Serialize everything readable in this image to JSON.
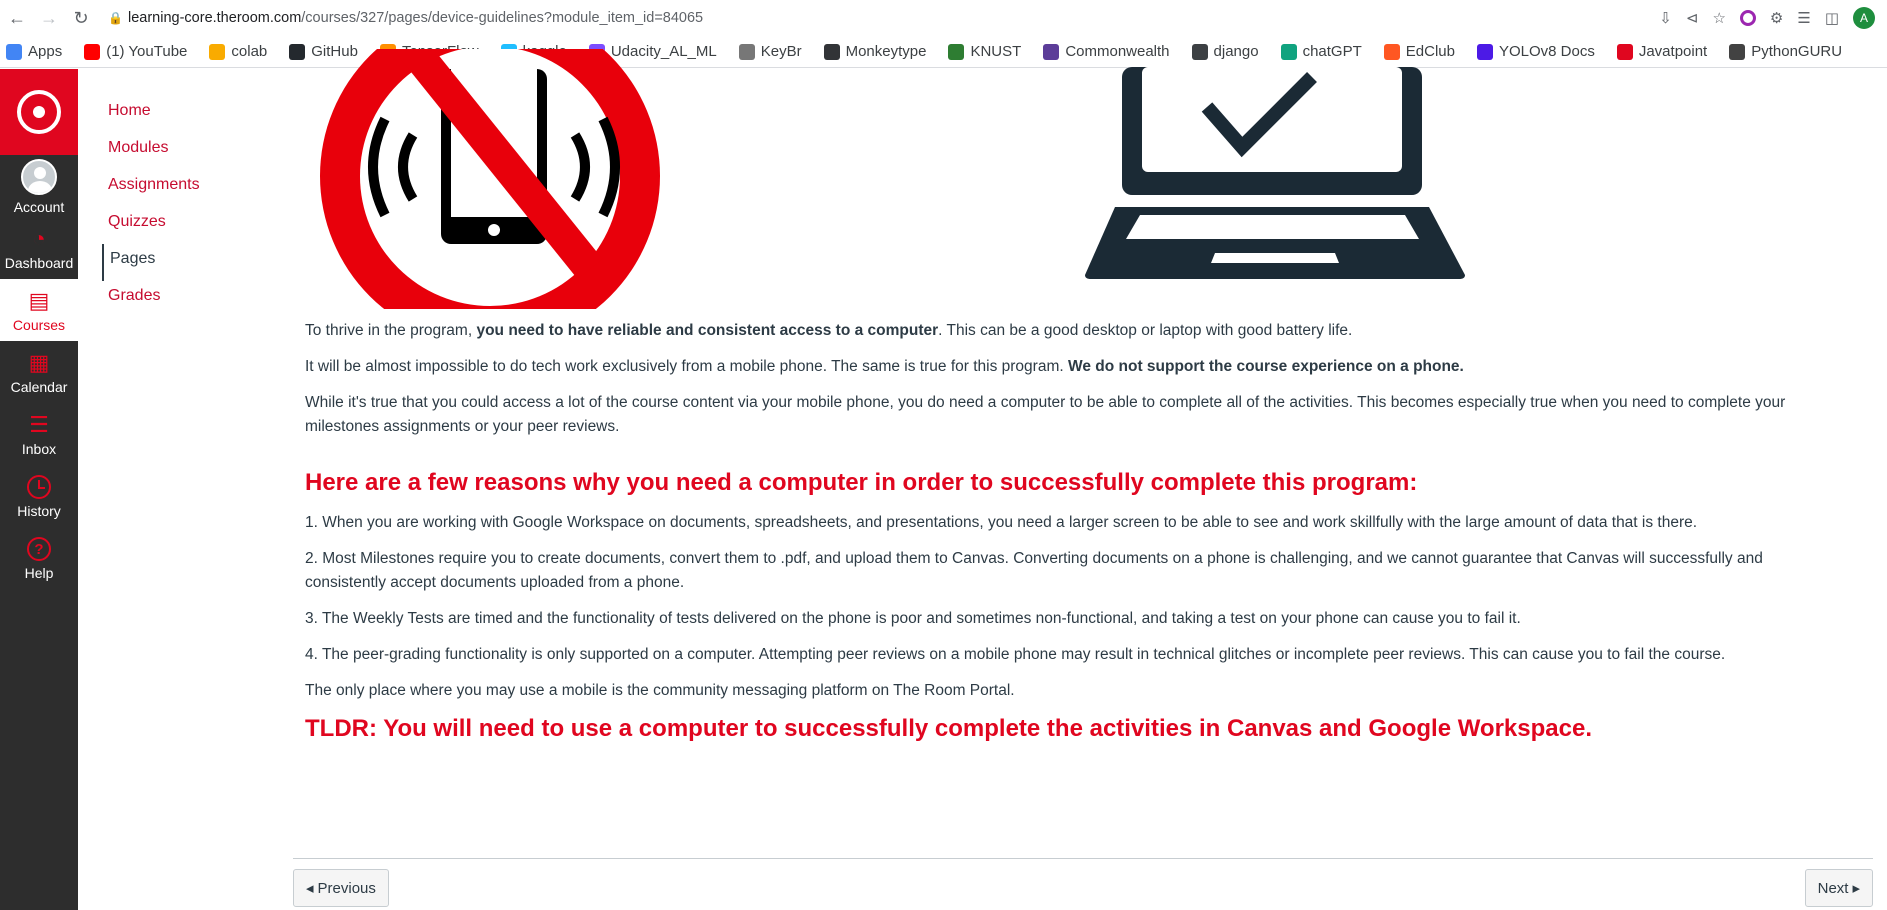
{
  "browser": {
    "url_host": "learning-core.theroom.com",
    "url_path": "/courses/327/pages/device-guidelines?module_item_id=84065",
    "avatar_letter": "A"
  },
  "bookmarks": [
    {
      "label": "Apps",
      "icon": "apps-grid-icon",
      "color": "#4285f4"
    },
    {
      "label": "(1) YouTube",
      "icon": "youtube-icon",
      "color": "#ff0000"
    },
    {
      "label": "colab",
      "icon": "colab-icon",
      "color": "#f9ab00"
    },
    {
      "label": "GitHub",
      "icon": "github-icon",
      "color": "#24292e"
    },
    {
      "label": "TensorFlow",
      "icon": "tensorflow-icon",
      "color": "#ff8f00"
    },
    {
      "label": "kaggle",
      "icon": "kaggle-icon",
      "color": "#20beff"
    },
    {
      "label": "Udacity_AL_ML",
      "icon": "udacity-icon",
      "color": "#7c4dff"
    },
    {
      "label": "KeyBr",
      "icon": "keybr-icon",
      "color": "#777777"
    },
    {
      "label": "Monkeytype",
      "icon": "monkeytype-icon",
      "color": "#323437"
    },
    {
      "label": "KNUST",
      "icon": "knust-icon",
      "color": "#2e7d32"
    },
    {
      "label": "Commonwealth",
      "icon": "commonwealth-icon",
      "color": "#5c3d99"
    },
    {
      "label": "django",
      "icon": "globe-icon",
      "color": "#3c4043"
    },
    {
      "label": "chatGPT",
      "icon": "chatgpt-icon",
      "color": "#10a37f"
    },
    {
      "label": "EdClub",
      "icon": "edclub-icon",
      "color": "#ff5722"
    },
    {
      "label": "YOLOv8 Docs",
      "icon": "yolo-icon",
      "color": "#4c1ae6"
    },
    {
      "label": "Javatpoint",
      "icon": "javatpoint-icon",
      "color": "#e0061f"
    },
    {
      "label": "PythonGURU",
      "icon": "pythonguru-icon",
      "color": "#424242"
    }
  ],
  "global_nav": {
    "items": [
      {
        "label": "Account",
        "icon": "user-avatar-icon"
      },
      {
        "label": "Dashboard",
        "icon": "dashboard-icon"
      },
      {
        "label": "Courses",
        "icon": "book-icon",
        "active": true
      },
      {
        "label": "Calendar",
        "icon": "calendar-icon"
      },
      {
        "label": "Inbox",
        "icon": "inbox-icon"
      },
      {
        "label": "History",
        "icon": "clock-icon"
      },
      {
        "label": "Help",
        "icon": "help-icon"
      }
    ],
    "brand_color": "#e0061f"
  },
  "course_nav": {
    "items": [
      "Home",
      "Modules",
      "Assignments",
      "Quizzes",
      "Pages",
      "Grades"
    ],
    "active": "Pages"
  },
  "page": {
    "p1_a": "To thrive in the program, ",
    "p1_b": "you need to have reliable and consistent access to a computer",
    "p1_c": ". This can be a good desktop or laptop with good battery life.",
    "p2_a": "It will be almost impossible to do tech work exclusively from a mobile phone. The same is true for this program. ",
    "p2_b": "We do not support the course experience on a phone.",
    "p3": "While it's true that you could access a lot of the course content via your mobile phone, you do need a computer to be able to complete all of the activities. This becomes especially true when you need to complete your milestones assignments or your peer reviews.",
    "heading": "Here are a few reasons why you need a computer in order to successfully complete this program:",
    "reasons": [
      "1. When you are working with Google Workspace on documents, spreadsheets, and presentations, you need a larger screen to be able to see and work skillfully with the large amount of data that is there.",
      "2. Most Milestones require you to create documents, convert them to .pdf, and upload them to Canvas. Converting documents on a phone is challenging, and we cannot guarantee that Canvas will successfully and consistently accept documents uploaded from a phone.",
      "3. The Weekly Tests are timed and the functionality of tests delivered on the phone is poor and sometimes non-functional, and taking a test on your phone can cause you to fail it.",
      "4. The peer-grading functionality is only supported on a computer. Attempting peer reviews on a mobile phone may result in technical glitches or incomplete peer reviews. This can cause you to fail the course."
    ],
    "note": "The only place where you may use a mobile is the community messaging platform on The Room Portal.",
    "tldr": "TLDR: You will need to use a computer to successfully complete the activities in Canvas and Google Workspace."
  },
  "pager": {
    "previous": "Previous",
    "next": "Next"
  }
}
